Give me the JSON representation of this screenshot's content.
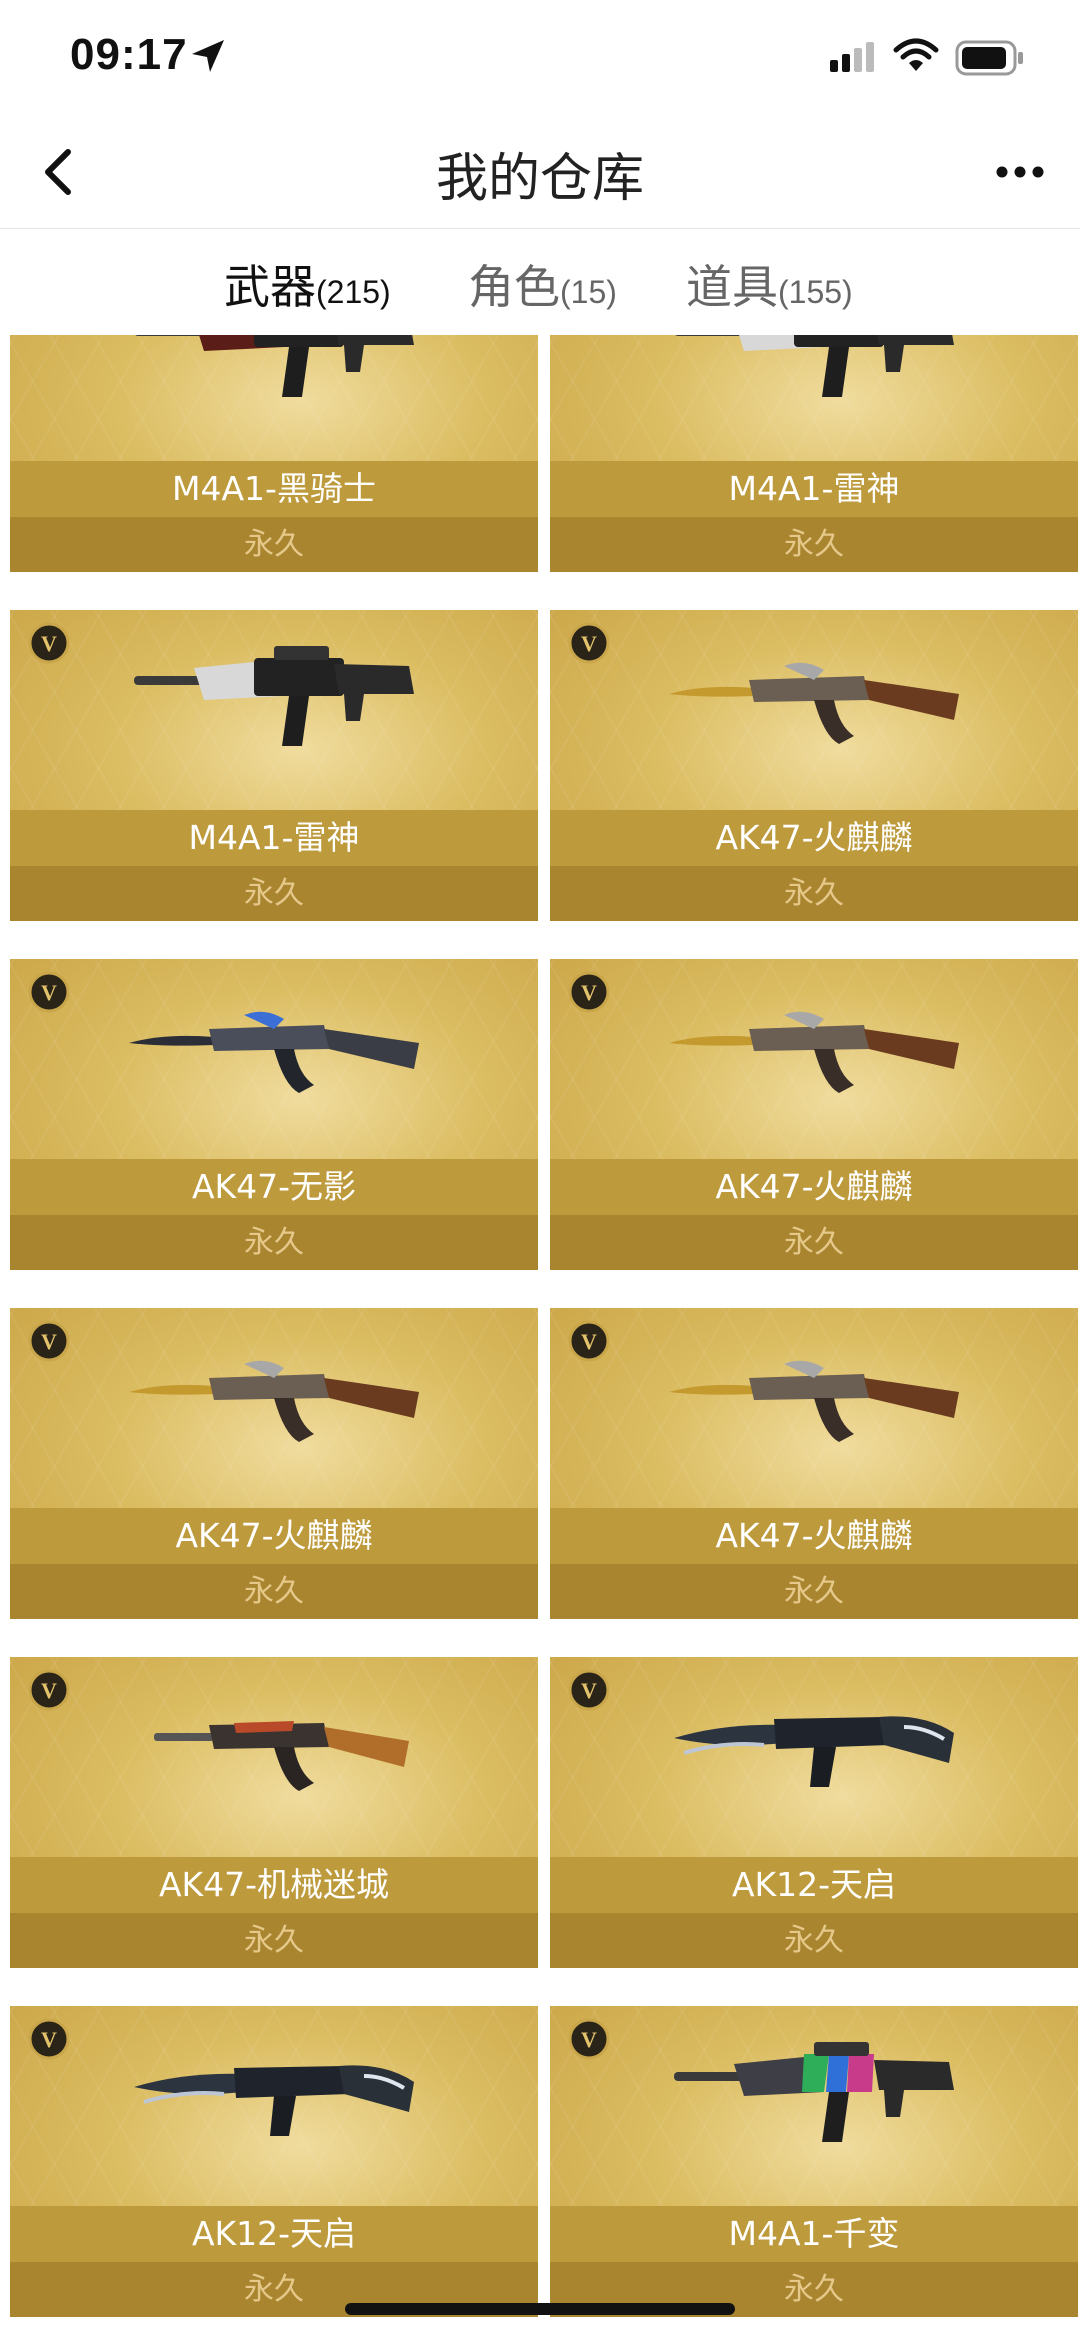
{
  "status": {
    "time": "09:17"
  },
  "nav": {
    "title": "我的仓库"
  },
  "tabs": [
    {
      "label": "武器",
      "count": "(215)"
    },
    {
      "label": "角色",
      "count": "(15)"
    },
    {
      "label": "道具",
      "count": "(155)"
    }
  ],
  "items": [
    {
      "name": "M4A1-黑骑士",
      "duration": "永久",
      "gun": "m4",
      "vip": false
    },
    {
      "name": "M4A1-雷神",
      "duration": "永久",
      "gun": "m4",
      "vip": false
    },
    {
      "name": "M4A1-雷神",
      "duration": "永久",
      "gun": "m4",
      "vip": true
    },
    {
      "name": "AK47-火麒麟",
      "duration": "永久",
      "gun": "ak",
      "vip": true
    },
    {
      "name": "AK47-无影",
      "duration": "永久",
      "gun": "ak",
      "vip": true
    },
    {
      "name": "AK47-火麒麟",
      "duration": "永久",
      "gun": "ak",
      "vip": true
    },
    {
      "name": "AK47-火麒麟",
      "duration": "永久",
      "gun": "ak",
      "vip": true
    },
    {
      "name": "AK47-火麒麟",
      "duration": "永久",
      "gun": "ak",
      "vip": true
    },
    {
      "name": "AK47-机械迷城",
      "duration": "永久",
      "gun": "ak",
      "vip": true
    },
    {
      "name": "AK12-天启",
      "duration": "永久",
      "gun": "ak12",
      "vip": true
    },
    {
      "name": "AK12-天启",
      "duration": "永久",
      "gun": "ak12",
      "vip": true
    },
    {
      "name": "M4A1-千变",
      "duration": "永久",
      "gun": "m4",
      "vip": true
    }
  ]
}
